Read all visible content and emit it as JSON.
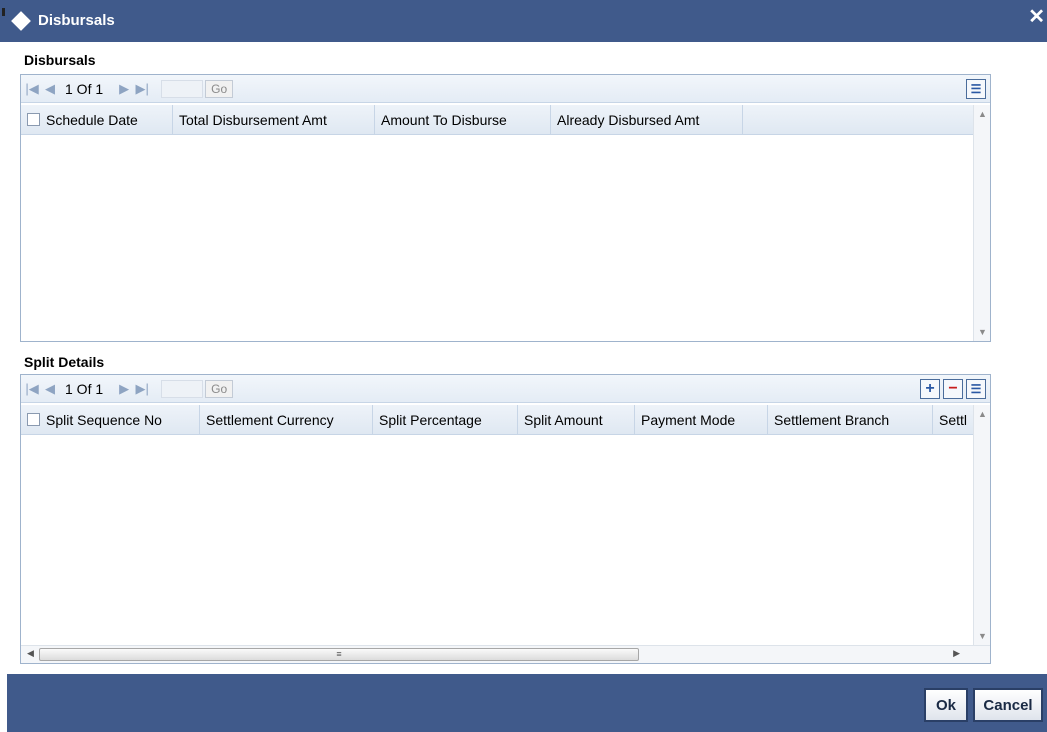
{
  "window": {
    "title": "Disbursals",
    "close_glyph": "✕"
  },
  "disbursals": {
    "section_label": "Disbursals",
    "pagination": {
      "text": "1 Of 1",
      "go_label": "Go"
    },
    "columns": [
      "Schedule Date",
      "Total Disbursement Amt",
      "Amount To Disburse",
      "Already Disbursed Amt"
    ],
    "rows": []
  },
  "split_details": {
    "section_label": "Split Details",
    "pagination": {
      "text": "1 Of 1",
      "go_label": "Go"
    },
    "columns": [
      "Split Sequence No",
      "Settlement Currency",
      "Split Percentage",
      "Split Amount",
      "Payment Mode",
      "Settlement Branch",
      "Settl"
    ],
    "rows": []
  },
  "footer": {
    "ok_label": "Ok",
    "cancel_label": "Cancel"
  },
  "icons": {
    "first": "first-page-icon",
    "prev": "prev-page-icon",
    "next": "next-page-icon",
    "last": "last-page-icon",
    "add": "add-row-icon",
    "delete": "delete-row-icon",
    "list": "single-view-icon"
  },
  "colors": {
    "titlebar": "#405a8b",
    "footer": "#405a8b",
    "grid_border": "#9fb3cc"
  }
}
